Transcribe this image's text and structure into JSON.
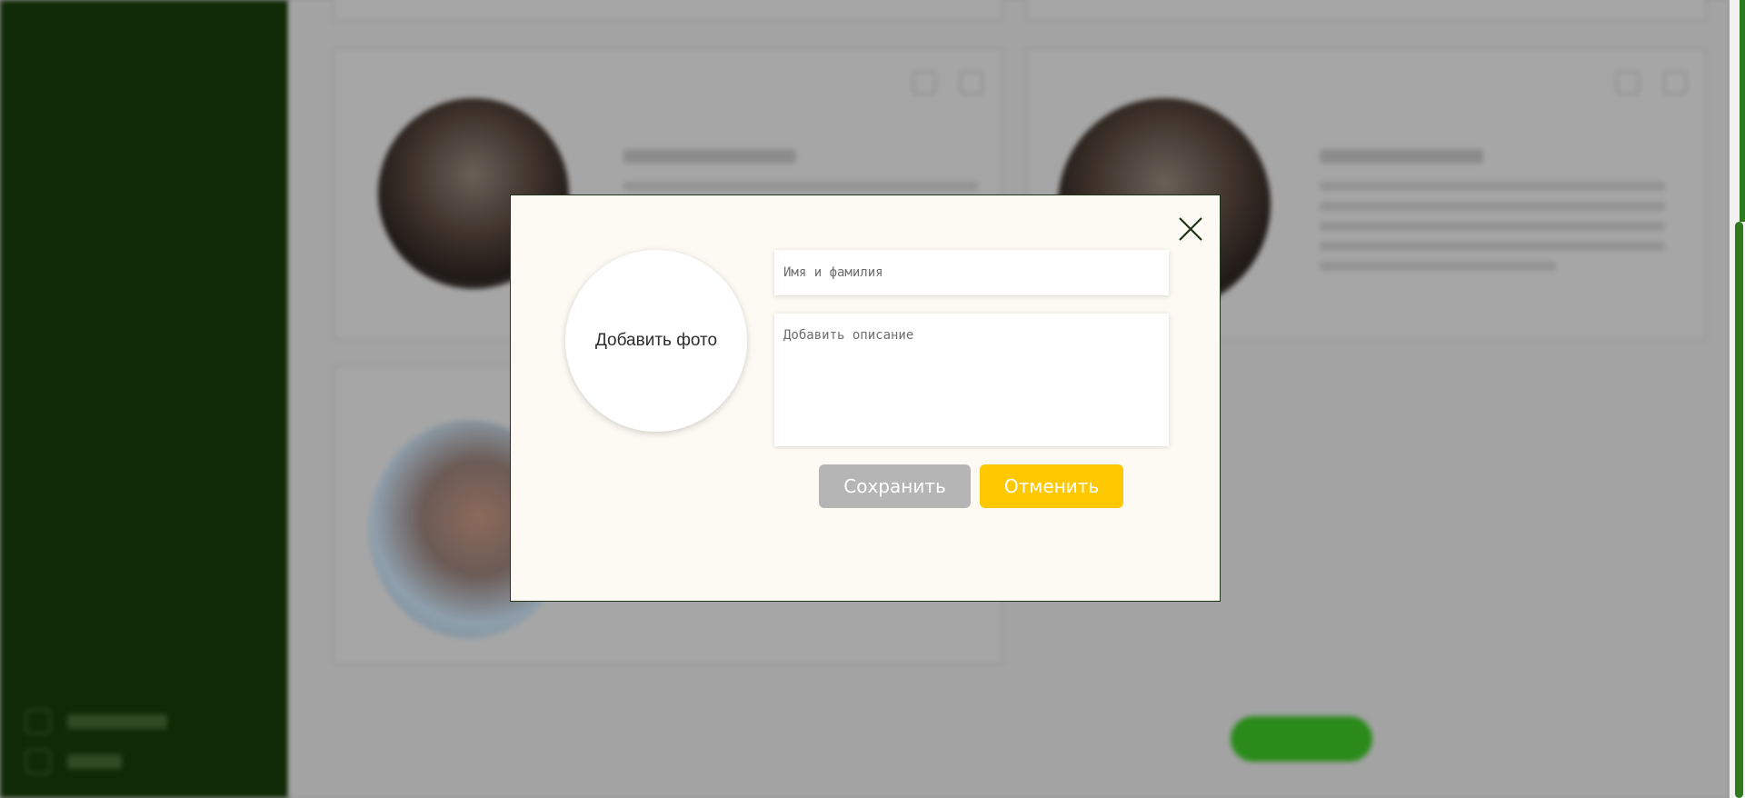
{
  "modal": {
    "photo_label": "Добавить фото",
    "name_placeholder": "Имя и фамилия",
    "description_placeholder": "Добавить описание",
    "save_label": "Сохранить",
    "cancel_label": "Отменить"
  },
  "colors": {
    "sidebar": "#0f2a05",
    "accent_green": "#2f7a1f",
    "cancel_yellow": "#ffc800",
    "save_gray": "#b5b5b5",
    "modal_bg": "#fdfaf3"
  },
  "icons": {
    "close": "close-icon",
    "edit": "edit-icon",
    "delete": "delete-icon"
  }
}
